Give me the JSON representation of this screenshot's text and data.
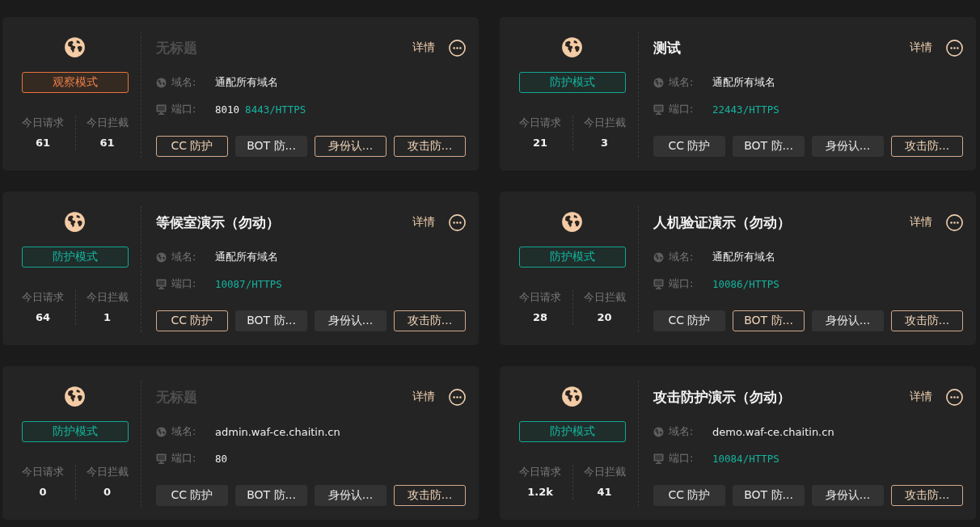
{
  "cards": [
    {
      "title": "无标题",
      "title_dimmed": true,
      "details_label": "详情",
      "mode": {
        "label": "观察模式",
        "kind": "observe"
      },
      "stats": [
        {
          "label": "今日请求",
          "value": "61"
        },
        {
          "label": "今日拦截",
          "value": "61"
        }
      ],
      "domain": {
        "label": "域名:",
        "value": "通配所有域名"
      },
      "port": {
        "label": "端口:",
        "values": [
          {
            "text": "8010",
            "kind": "http"
          },
          {
            "text": "8443/HTTPS",
            "kind": "https"
          }
        ]
      },
      "tags": [
        {
          "label": "CC 防护",
          "on": true
        },
        {
          "label": "BOT 防...",
          "on": false
        },
        {
          "label": "身份认...",
          "on": true
        },
        {
          "label": "攻击防...",
          "on": true
        }
      ]
    },
    {
      "title": "测试",
      "title_dimmed": false,
      "details_label": "详情",
      "mode": {
        "label": "防护模式",
        "kind": "protect"
      },
      "stats": [
        {
          "label": "今日请求",
          "value": "21"
        },
        {
          "label": "今日拦截",
          "value": "3"
        }
      ],
      "domain": {
        "label": "域名:",
        "value": "通配所有域名"
      },
      "port": {
        "label": "端口:",
        "values": [
          {
            "text": "22443/HTTPS",
            "kind": "https"
          }
        ]
      },
      "tags": [
        {
          "label": "CC 防护",
          "on": false
        },
        {
          "label": "BOT 防...",
          "on": false
        },
        {
          "label": "身份认...",
          "on": false
        },
        {
          "label": "攻击防...",
          "on": true
        }
      ]
    },
    {
      "title": "等候室演示（勿动）",
      "title_dimmed": false,
      "details_label": "详情",
      "mode": {
        "label": "防护模式",
        "kind": "protect"
      },
      "stats": [
        {
          "label": "今日请求",
          "value": "64"
        },
        {
          "label": "今日拦截",
          "value": "1"
        }
      ],
      "domain": {
        "label": "域名:",
        "value": "通配所有域名"
      },
      "port": {
        "label": "端口:",
        "values": [
          {
            "text": "10087/HTTPS",
            "kind": "https"
          }
        ]
      },
      "tags": [
        {
          "label": "CC 防护",
          "on": true
        },
        {
          "label": "BOT 防...",
          "on": false
        },
        {
          "label": "身份认...",
          "on": false
        },
        {
          "label": "攻击防...",
          "on": true
        }
      ]
    },
    {
      "title": "人机验证演示（勿动）",
      "title_dimmed": false,
      "details_label": "详情",
      "mode": {
        "label": "防护模式",
        "kind": "protect"
      },
      "stats": [
        {
          "label": "今日请求",
          "value": "28"
        },
        {
          "label": "今日拦截",
          "value": "20"
        }
      ],
      "domain": {
        "label": "域名:",
        "value": "通配所有域名"
      },
      "port": {
        "label": "端口:",
        "values": [
          {
            "text": "10086/HTTPS",
            "kind": "https"
          }
        ]
      },
      "tags": [
        {
          "label": "CC 防护",
          "on": false
        },
        {
          "label": "BOT 防...",
          "on": true
        },
        {
          "label": "身份认...",
          "on": false
        },
        {
          "label": "攻击防...",
          "on": true
        }
      ]
    },
    {
      "title": "无标题",
      "title_dimmed": true,
      "details_label": "详情",
      "mode": {
        "label": "防护模式",
        "kind": "protect"
      },
      "stats": [
        {
          "label": "今日请求",
          "value": "0"
        },
        {
          "label": "今日拦截",
          "value": "0"
        }
      ],
      "domain": {
        "label": "域名:",
        "value": "admin.waf-ce.chaitin.cn"
      },
      "port": {
        "label": "端口:",
        "values": [
          {
            "text": "80",
            "kind": "http"
          }
        ]
      },
      "tags": [
        {
          "label": "CC 防护",
          "on": false
        },
        {
          "label": "BOT 防...",
          "on": false
        },
        {
          "label": "身份认...",
          "on": false
        },
        {
          "label": "攻击防...",
          "on": true
        }
      ]
    },
    {
      "title": "攻击防护演示（勿动）",
      "title_dimmed": false,
      "details_label": "详情",
      "mode": {
        "label": "防护模式",
        "kind": "protect"
      },
      "stats": [
        {
          "label": "今日请求",
          "value": "1.2k"
        },
        {
          "label": "今日拦截",
          "value": "41"
        }
      ],
      "domain": {
        "label": "域名:",
        "value": "demo.waf-ce.chaitin.cn"
      },
      "port": {
        "label": "端口:",
        "values": [
          {
            "text": "10084/HTTPS",
            "kind": "https"
          }
        ]
      },
      "tags": [
        {
          "label": "CC 防护",
          "on": false
        },
        {
          "label": "BOT 防...",
          "on": false
        },
        {
          "label": "身份认...",
          "on": false
        },
        {
          "label": "攻击防...",
          "on": true
        }
      ]
    }
  ]
}
